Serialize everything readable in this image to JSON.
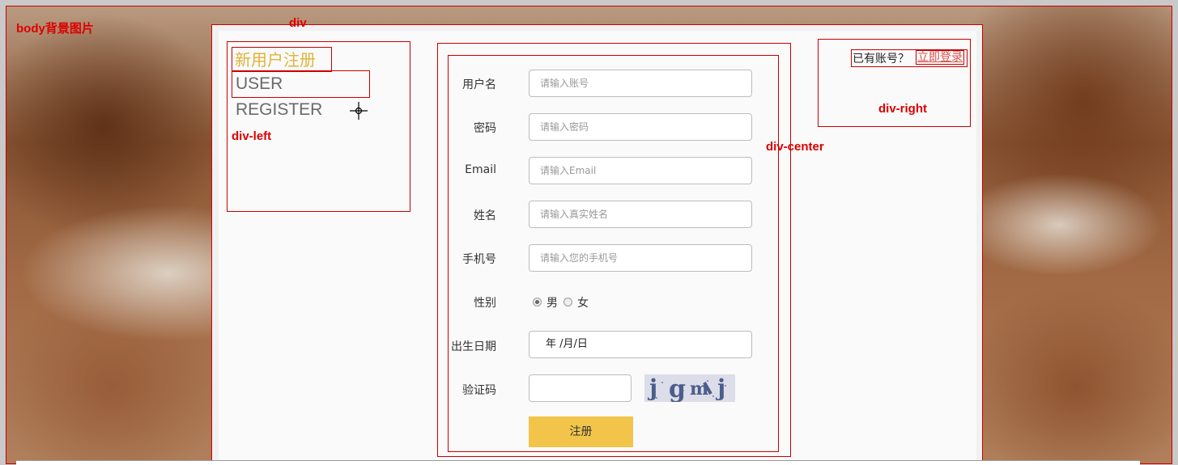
{
  "annotations": {
    "body": "body背景图片",
    "div": "div",
    "left": "div-left",
    "center": "div-center",
    "right": "div-right"
  },
  "left": {
    "title_cn": "新用户注册",
    "title_en": "USER REGISTER"
  },
  "form": {
    "fields": [
      {
        "label": "用户名",
        "placeholder": "请输入账号"
      },
      {
        "label": "密码",
        "placeholder": "请输入密码"
      },
      {
        "label": "Email",
        "placeholder": "请输入Email"
      },
      {
        "label": "姓名",
        "placeholder": "请输入真实姓名"
      },
      {
        "label": "手机号",
        "placeholder": "请输入您的手机号"
      }
    ],
    "gender": {
      "label": "性别",
      "options": [
        "男",
        "女"
      ],
      "selected": "男"
    },
    "birth": {
      "label": "出生日期",
      "value": "年 /月/日"
    },
    "captcha": {
      "label": "验证码",
      "code": "jgmj"
    },
    "submit_label": "注册"
  },
  "right": {
    "prompt": "已有账号？",
    "login_link": "立即登录"
  },
  "colors": {
    "annotation_red": "#dd0000",
    "title_gold": "#e0b33a",
    "button_yellow": "#f2c54a",
    "link_red": "#d9534f"
  }
}
